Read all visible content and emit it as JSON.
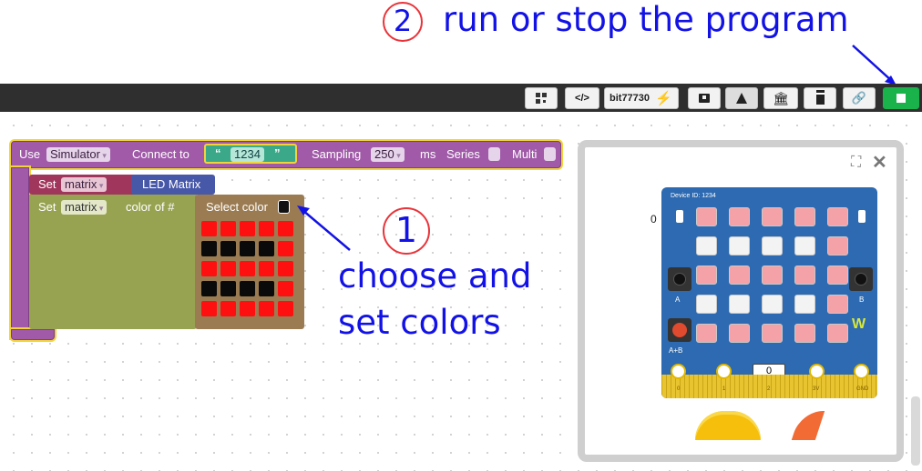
{
  "annotations": {
    "step2_number": "2",
    "step2_text": "run or stop the program",
    "step1_number": "1",
    "step1_text_line1": "choose and",
    "step1_text_line2": "set colors"
  },
  "toolbar": {
    "qr_icon": "qr-code-icon",
    "code_icon": "</>",
    "device_id_value": "bit77730",
    "bolt_icon": "lightning-icon",
    "save_icon": "download-box-icon",
    "lab_icon": "flask-icon",
    "library_icon": "bank-icon",
    "trash_icon": "trash-icon",
    "link_icon": "link-icon",
    "run_stop_icon": "stop-square-icon",
    "colors": {
      "bg": "#2f2f2f",
      "run": "#19b24b"
    }
  },
  "blocks": {
    "use_label": "Use",
    "use_value": "Simulator",
    "connect_label": "Connect to",
    "connect_value": "1234",
    "sampling_label": "Sampling",
    "sampling_value": "250",
    "ms_label": "ms",
    "series_label": "Series",
    "multi_label": "Multi",
    "set1_label": "Set",
    "set1_var": "matrix",
    "set1_value": "LED Matrix",
    "set2_label": "Set",
    "set2_var": "matrix",
    "set2_suffix": "color of #",
    "select_color_label": "Select color",
    "color_grid": [
      [
        "red",
        "red",
        "red",
        "red",
        "red"
      ],
      [
        "black",
        "black",
        "black",
        "black",
        "red"
      ],
      [
        "red",
        "red",
        "red",
        "red",
        "red"
      ],
      [
        "black",
        "black",
        "black",
        "black",
        "red"
      ],
      [
        "red",
        "red",
        "red",
        "red",
        "red"
      ]
    ]
  },
  "simulator": {
    "device_id_label": "Device ID: 1234",
    "left_value": "0",
    "button_a": "A",
    "button_b": "B",
    "button_ab": "A+B",
    "bottom_value": "0",
    "pins": [
      "0",
      "1",
      "2",
      "3V",
      "GND"
    ],
    "led_grid": [
      [
        "red",
        "red",
        "red",
        "red",
        "red"
      ],
      [
        "white",
        "white",
        "white",
        "white",
        "red"
      ],
      [
        "red",
        "red",
        "red",
        "red",
        "red"
      ],
      [
        "white",
        "white",
        "white",
        "white",
        "red"
      ],
      [
        "red",
        "red",
        "red",
        "red",
        "red"
      ]
    ]
  }
}
